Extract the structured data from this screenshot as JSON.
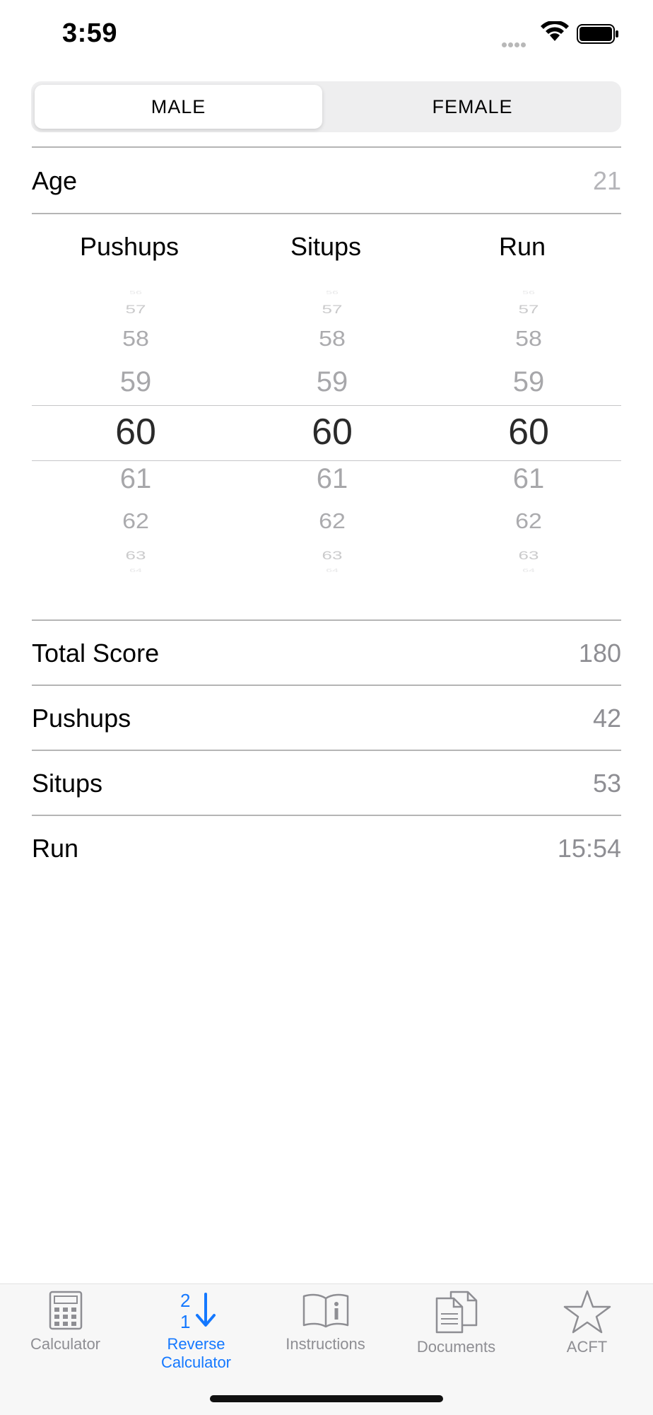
{
  "status_bar": {
    "time": "3:59"
  },
  "gender_toggle": {
    "male": "MALE",
    "female": "FEMALE",
    "selected": "MALE"
  },
  "age": {
    "label": "Age",
    "value": "21"
  },
  "picker": {
    "columns": [
      {
        "label": "Pushups",
        "values": [
          "56",
          "57",
          "58",
          "59",
          "60",
          "61",
          "62",
          "63",
          "64"
        ],
        "selected": "60"
      },
      {
        "label": "Situps",
        "values": [
          "56",
          "57",
          "58",
          "59",
          "60",
          "61",
          "62",
          "63",
          "64"
        ],
        "selected": "60"
      },
      {
        "label": "Run",
        "values": [
          "56",
          "57",
          "58",
          "59",
          "60",
          "61",
          "62",
          "63",
          "64"
        ],
        "selected": "60"
      }
    ]
  },
  "results": {
    "total_score": {
      "label": "Total Score",
      "value": "180"
    },
    "pushups": {
      "label": "Pushups",
      "value": "42"
    },
    "situps": {
      "label": "Situps",
      "value": "53"
    },
    "run": {
      "label": "Run",
      "value": "15:54"
    }
  },
  "tabs": [
    {
      "label": "Calculator",
      "icon": "calculator-icon",
      "active": false
    },
    {
      "label": "Reverse Calculator",
      "icon": "reverse-sort-icon",
      "active": true,
      "icon_digits": [
        "2",
        "1"
      ]
    },
    {
      "label": "Instructions",
      "icon": "book-info-icon",
      "active": false
    },
    {
      "label": "Documents",
      "icon": "documents-icon",
      "active": false
    },
    {
      "label": "ACFT",
      "icon": "star-icon",
      "active": false
    }
  ],
  "colors": {
    "accent": "#1478ff",
    "value_gray": "#8e8e93",
    "divider": "#b5b5b5"
  }
}
